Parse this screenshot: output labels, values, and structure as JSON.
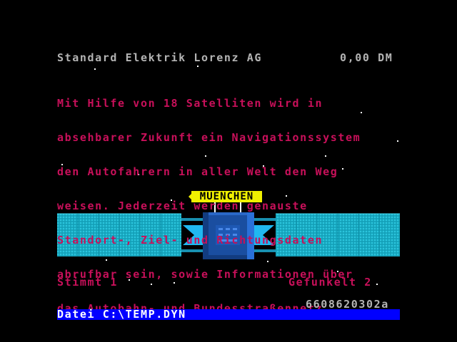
{
  "header": {
    "company": "Standard Elektrik Lorenz AG",
    "price": "0,00 DM"
  },
  "description": {
    "lines": [
      "Mit Hilfe von 18 Satelliten wird in",
      "absehbarer Zukunft ein Navigationssystem",
      "den Autofahrern in aller Welt den Weg",
      "weisen. Jederzeit werden genauste",
      "Standort-, Ziel- und Richtungsdaten",
      "abrufbar sein, sowie Informationen über",
      "das Autobahn- und Bundesstraßennetz."
    ]
  },
  "satellite": {
    "city_label": "MUENCHEN"
  },
  "stats": {
    "stimmt": "Stimmt 1",
    "gefunkelt": "Gefunkelt 2"
  },
  "code": "6608620302a",
  "statusbar": {
    "text": "Datei C:\\TEMP.DYN"
  },
  "colors": {
    "background": "#000000",
    "header_text": "#b4b4b4",
    "body_text": "#c8105a",
    "status_bar": "#0000ff",
    "label_bg": "#f0f000",
    "panel": "#18b4c8"
  }
}
